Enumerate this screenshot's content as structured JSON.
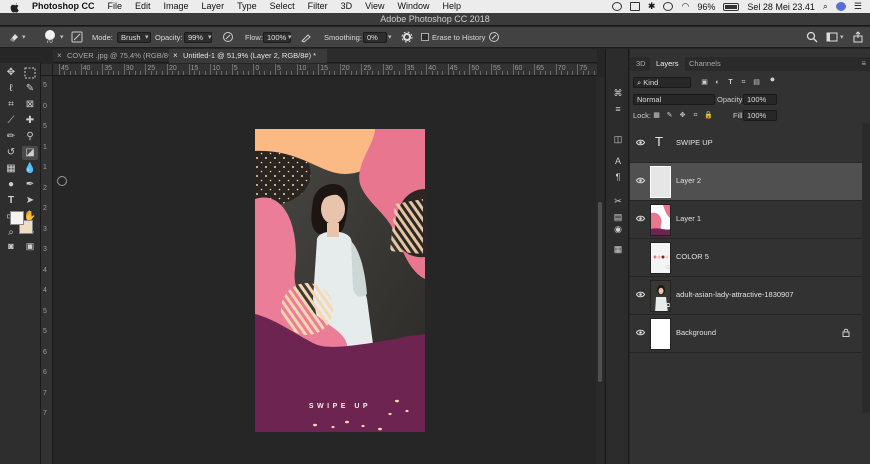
{
  "menubar": {
    "items": [
      "Photoshop CC",
      "File",
      "Edit",
      "Image",
      "Layer",
      "Type",
      "Select",
      "Filter",
      "3D",
      "View",
      "Window",
      "Help"
    ],
    "battery": "96%",
    "datetime": "Sel 28 Mei  23.41"
  },
  "window": {
    "title": "Adobe Photoshop CC 2018"
  },
  "options": {
    "brush_size": "70",
    "mode_label": "Mode:",
    "mode_value": "Brush",
    "opacity_label": "Opacity:",
    "opacity_value": "99%",
    "flow_label": "Flow:",
    "flow_value": "100%",
    "smoothing_label": "Smoothing:",
    "smoothing_value": "0%",
    "erase_to_history": "Erase to History"
  },
  "documents": {
    "tabs": [
      {
        "label": "COVER .jpg @ 75,4% (RGB/8*)"
      },
      {
        "label": "Untitled-1 @ 51,9% (Layer 2, RGB/8#) *"
      }
    ]
  },
  "ruler": {
    "h_marks": [
      "45",
      "40",
      "35",
      "30",
      "25",
      "20",
      "15",
      "10",
      "5",
      "0",
      "5",
      "10",
      "15",
      "20",
      "25",
      "30",
      "35",
      "40",
      "45",
      "50",
      "55",
      "60",
      "65",
      "70",
      "75"
    ],
    "v_marks": [
      "5",
      "0",
      "5",
      "1",
      "1",
      "2",
      "2",
      "3",
      "3",
      "4",
      "4",
      "5",
      "5",
      "6",
      "6",
      "7",
      "7"
    ]
  },
  "artwork": {
    "caption": "SWIPE UP"
  },
  "panel": {
    "tabs": [
      "3D",
      "Layers",
      "Channels"
    ],
    "filter_kind": "Kind",
    "blend_mode": "Normal",
    "opacity_label": "Opacity:",
    "opacity_value": "100%",
    "lock_label": "Lock:",
    "fill_label": "Fill:",
    "fill_value": "100%",
    "layers": [
      {
        "name": "SWIPE UP",
        "kind": "text",
        "visible": true
      },
      {
        "name": "Layer 2",
        "kind": "pixel",
        "visible": true,
        "selected": true
      },
      {
        "name": "Layer 1",
        "kind": "pixel",
        "visible": true
      },
      {
        "name": "COLOR 5",
        "kind": "smart",
        "visible": false
      },
      {
        "name": "adult-asian-lady-attractive-1830907",
        "kind": "smart",
        "visible": true
      },
      {
        "name": "Background",
        "kind": "background",
        "visible": true,
        "locked": true
      }
    ]
  }
}
